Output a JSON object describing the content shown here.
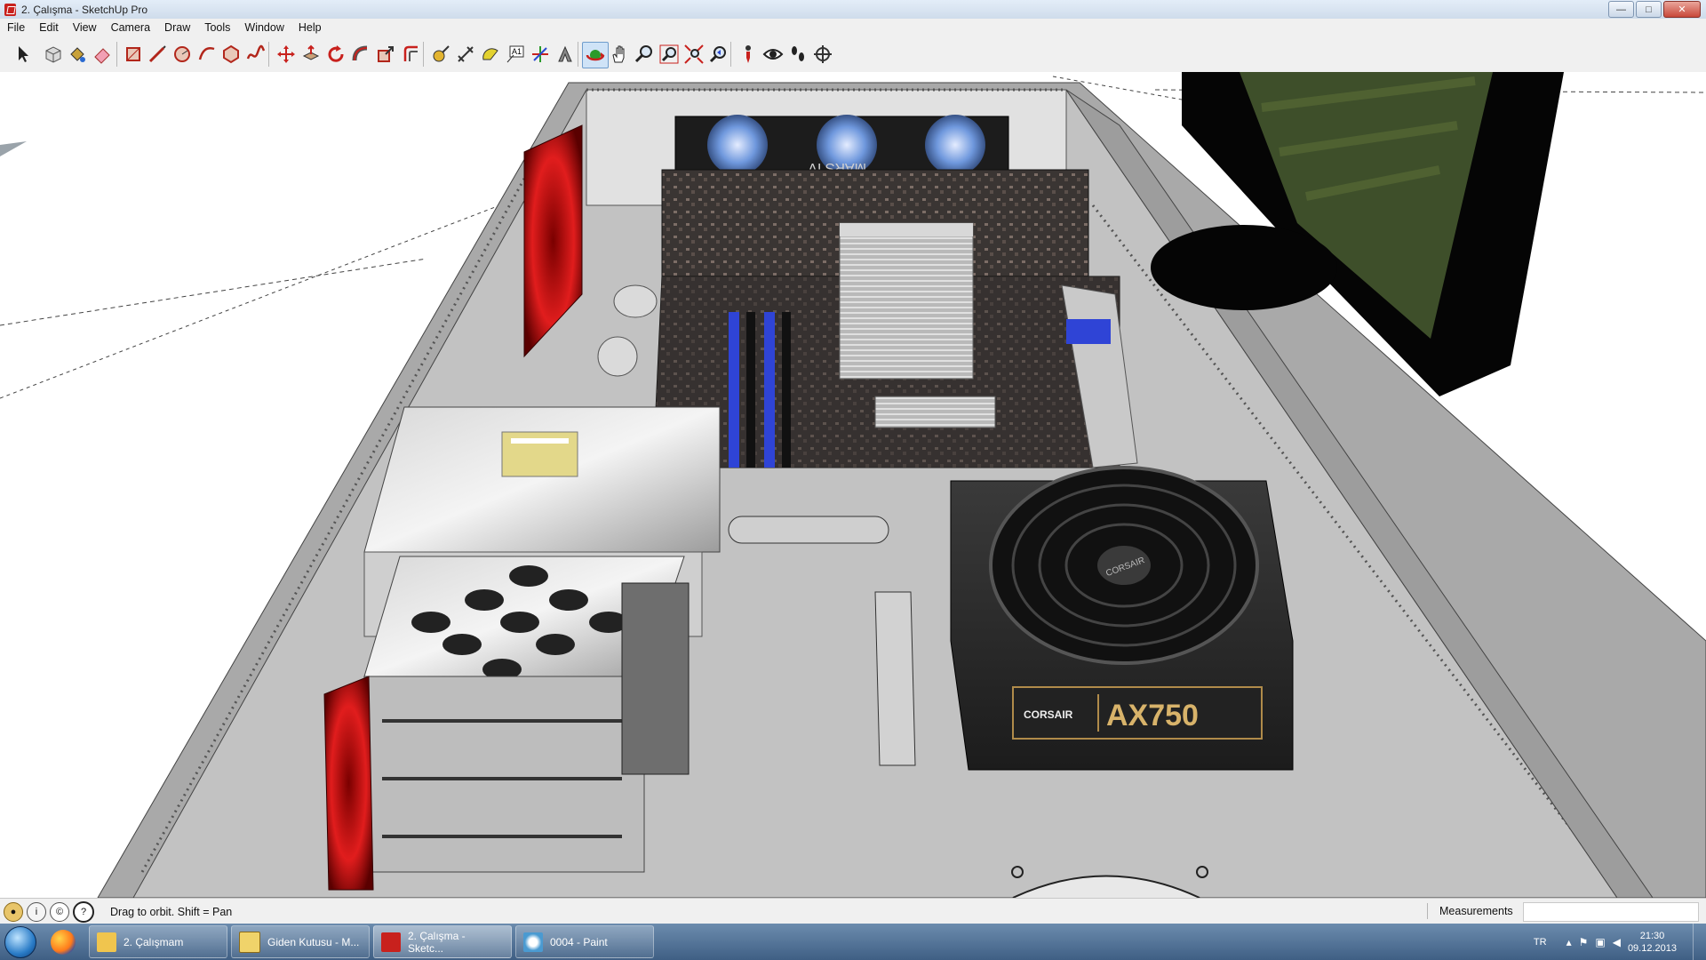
{
  "window": {
    "title": "2. Çalışma - SketchUp Pro",
    "controls": {
      "minimize": "—",
      "maximize": "□",
      "close": "✕"
    }
  },
  "menu": [
    "File",
    "Edit",
    "View",
    "Camera",
    "Draw",
    "Tools",
    "Window",
    "Help"
  ],
  "toolbar": {
    "tools": [
      "select-icon",
      "make-component-icon",
      "paint-bucket-icon",
      "eraser-icon",
      "rectangle-icon",
      "line-icon",
      "circle-icon",
      "arc-icon",
      "polygon-icon",
      "freehand-icon",
      "move-icon",
      "push-pull-icon",
      "rotate-icon",
      "follow-me-icon",
      "scale-icon",
      "offset-icon",
      "tape-measure-icon",
      "dimension-icon",
      "protractor-icon",
      "text-icon",
      "axes-icon",
      "3d-text-icon",
      "orbit-icon",
      "pan-icon",
      "zoom-icon",
      "zoom-window-icon",
      "zoom-extents-icon",
      "previous-view-icon",
      "position-camera-icon",
      "look-around-icon",
      "walk-icon",
      "section-plane-icon"
    ],
    "active_tool": "orbit-icon"
  },
  "scene": {
    "labels": {
      "gpu_text": "MARS IV",
      "psu_brand": "CORSAIR",
      "psu_model": "AX750",
      "psu_fan_brand": "CORSAIR"
    }
  },
  "status": {
    "hint": "Drag to orbit.  Shift = Pan",
    "measurements_label": "Measurements",
    "measurements_value": ""
  },
  "taskbar": {
    "items": [
      {
        "label": "2. Çalışmam",
        "icon": "folder-icon"
      },
      {
        "label": "Giden Kutusu - M...",
        "icon": "outlook-icon"
      },
      {
        "label": "2. Çalışma - Sketc...",
        "icon": "sketchup-icon",
        "active": true
      },
      {
        "label": "0004 - Paint",
        "icon": "paint-icon"
      }
    ],
    "tray": {
      "language": "TR",
      "time": "21:30",
      "date": "09.12.2013"
    }
  },
  "colors": {
    "case_grey": "#9a9a9a",
    "fan_red": "#d11a1a",
    "fan_blue": "#4a7fd0",
    "dimm_blue": "#2f44d6"
  }
}
